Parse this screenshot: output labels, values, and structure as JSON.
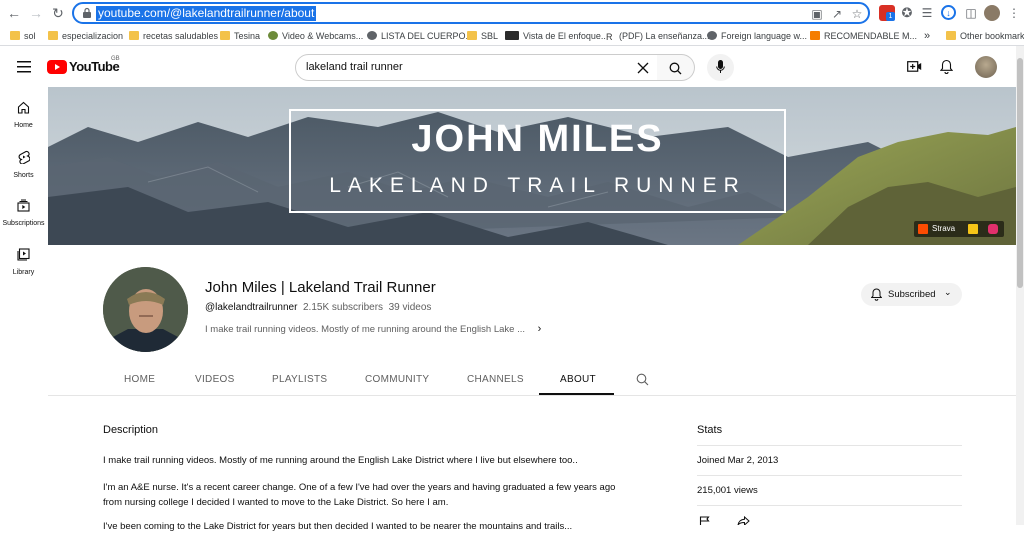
{
  "browser": {
    "url": "youtube.com/@lakelandtrailrunner/about",
    "ext_badge": "1",
    "bookmarks": [
      {
        "label": "sol",
        "icon": "folder-icon"
      },
      {
        "label": "especializacion",
        "icon": "folder-icon"
      },
      {
        "label": "recetas saludables",
        "icon": "folder-icon"
      },
      {
        "label": "Tesina",
        "icon": "folder-icon"
      },
      {
        "label": "Video & Webcams...",
        "icon": "paw-icon"
      },
      {
        "label": "LISTA DEL CUERPO...",
        "icon": "globe-icon"
      },
      {
        "label": "SBL",
        "icon": "folder-icon"
      },
      {
        "label": "Vista de El enfoque...",
        "icon": "pkp-icon"
      },
      {
        "label": "(PDF) La enseñanza...",
        "icon": "researchgate-icon"
      },
      {
        "label": "Foreign language w...",
        "icon": "globe-icon"
      },
      {
        "label": "RECOMENDABLE M...",
        "icon": "blogger-icon"
      }
    ],
    "bookmarks_overflow": "»",
    "other_bookmarks": "Other bookmarks"
  },
  "header": {
    "logo_text": "YouTube",
    "logo_region": "GB",
    "search_value": "lakeland trail runner"
  },
  "rail": [
    {
      "label": "Home",
      "icon": "home-icon"
    },
    {
      "label": "Shorts",
      "icon": "shorts-icon"
    },
    {
      "label": "Subscriptions",
      "icon": "subscriptions-icon"
    },
    {
      "label": "Library",
      "icon": "library-icon"
    }
  ],
  "banner": {
    "title": "JOHN MILES",
    "subtitle": "LAKELAND TRAIL RUNNER",
    "strava_label": "Strava"
  },
  "channel": {
    "name": "John Miles | Lakeland Trail Runner",
    "handle": "@lakelandtrailrunner",
    "subscribers": "2.15K subscribers",
    "videos": "39 videos",
    "tagline": "I make trail running videos. Mostly of me running around the English Lake ...",
    "subscribe_label": "Subscribed"
  },
  "tabs": [
    {
      "label": "HOME",
      "active": false
    },
    {
      "label": "VIDEOS",
      "active": false
    },
    {
      "label": "PLAYLISTS",
      "active": false
    },
    {
      "label": "COMMUNITY",
      "active": false
    },
    {
      "label": "CHANNELS",
      "active": false
    },
    {
      "label": "ABOUT",
      "active": true
    }
  ],
  "about": {
    "description_title": "Description",
    "paragraphs": [
      "I make trail running videos. Mostly of me running around the English Lake District where I live but elsewhere too..",
      "I'm an A&E nurse. It's a recent career change. One of a few I've had over the years and having graduated a few years ago from nursing college I decided I wanted to move to the Lake District. So here I am.",
      "I've been coming to the Lake District for years but then decided I wanted to be nearer the mountains and trails..."
    ],
    "stats_title": "Stats",
    "joined": "Joined Mar 2, 2013",
    "views": "215,001 views"
  },
  "colors": {
    "accent": "#1a73e8",
    "youtube_red": "#ff0000",
    "strava": "#fc4c02"
  }
}
